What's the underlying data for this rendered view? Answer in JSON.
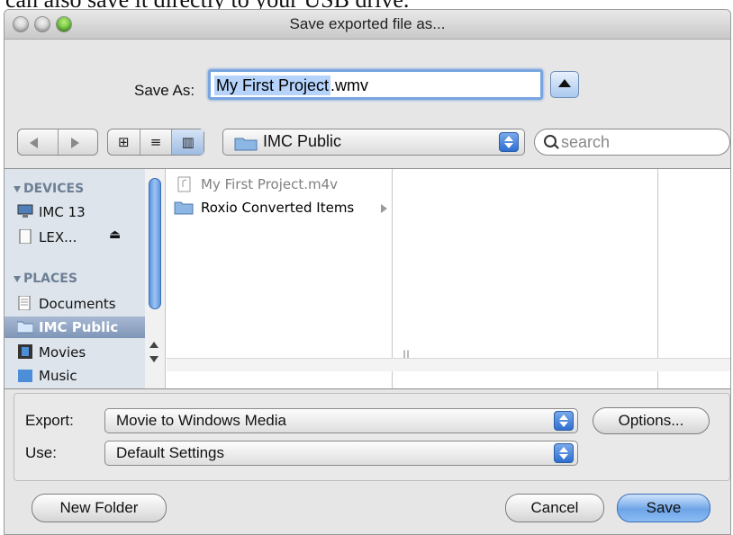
{
  "caption_text": "can also save it directly to your USB drive.",
  "window": {
    "title": "Save exported file as..."
  },
  "save_as": {
    "label": "Save As:",
    "filename": "My First Project",
    "extension": ".wmv"
  },
  "location": {
    "current_folder": "IMC Public"
  },
  "search": {
    "placeholder": "search"
  },
  "sidebar": {
    "devices_header": "DEVICES",
    "devices": [
      {
        "label": "IMC 13",
        "icon": "computer-icon"
      },
      {
        "label": "LEX...",
        "icon": "drive-icon"
      }
    ],
    "places_header": "PLACES",
    "places": [
      {
        "label": "Documents",
        "icon": "folder-icon"
      },
      {
        "label": "IMC Public",
        "icon": "folder-icon",
        "selected": true
      },
      {
        "label": "Movies",
        "icon": "film-icon"
      },
      {
        "label": "Music",
        "icon": "music-icon"
      }
    ]
  },
  "files": [
    {
      "name": "My First Project.m4v",
      "icon": "movie-file-icon",
      "dimmed": true
    },
    {
      "name": "Roxio Converted Items",
      "icon": "folder-icon",
      "has_children": true
    }
  ],
  "options": {
    "export_label": "Export:",
    "export_value": "Movie to Windows Media",
    "options_button": "Options...",
    "use_label": "Use:",
    "use_value": "Default Settings"
  },
  "buttons": {
    "new_folder": "New Folder",
    "cancel": "Cancel",
    "save": "Save"
  },
  "colors": {
    "accent": "#5d95df",
    "selection": "#8aa2c4",
    "default_button": "#6ea4e8"
  }
}
